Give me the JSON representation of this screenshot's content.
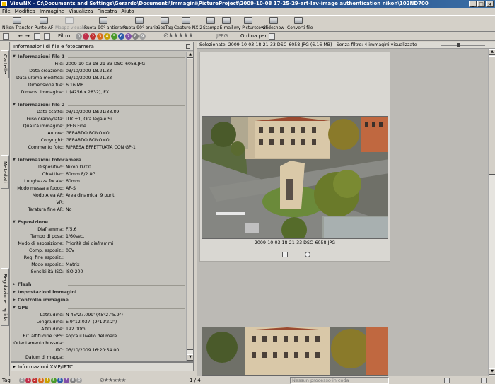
{
  "window": {
    "title": "ViewNX - C:\\Documents and Settings\\Gerardo\\Documenti\\Immagini\\PictureProject\\2009-10-08 17-25-29-art-lav-image authentication nikon\\102ND700",
    "buttons": [
      "_",
      "□",
      "×"
    ]
  },
  "menu": [
    "File",
    "Modifica",
    "Immagine",
    "Visualizza",
    "Finestra",
    "Aiuto"
  ],
  "toolbar": {
    "buttons": [
      {
        "label": "Nikon Transfer",
        "enabled": true
      },
      {
        "label": "Punto AF",
        "enabled": true
      },
      {
        "label": "Mappa visuale",
        "enabled": false
      },
      {
        "label": "Ruota 90° antiorario",
        "enabled": true
      },
      {
        "label": "Ruota 90° orario",
        "enabled": true
      },
      {
        "label": "GeoTag",
        "enabled": true
      },
      {
        "label": "Capture NX 2",
        "enabled": true
      },
      {
        "label": "Stampa",
        "enabled": true
      },
      {
        "label": "E-mail",
        "enabled": true
      },
      {
        "label": "my Picturetown",
        "enabled": true
      },
      {
        "label": "Slideshow",
        "enabled": true
      },
      {
        "label": "Converti file",
        "enabled": true
      }
    ]
  },
  "toolbar2": {
    "filter_label": "Filtro",
    "labels": [
      "0",
      "1",
      "2",
      "3",
      "4",
      "5",
      "6",
      "7",
      "8",
      "9"
    ],
    "label_colors": [
      "#9a9a9a",
      "#c0304a",
      "#c03030",
      "#d86a1c",
      "#c8a000",
      "#4a9a2a",
      "#2a5aaa",
      "#8050a8",
      "#808080",
      "#a0a0a0"
    ],
    "stars": "⊘★★★★★",
    "filetype": "JPEG",
    "sort_label": "Ordina per"
  },
  "left_tabs": [
    "Cartelle",
    "Metadati",
    "Regolazione rapida"
  ],
  "panel": {
    "title": "Informazioni di file e fotocamera",
    "sections": [
      {
        "title": "Informazioni file 1",
        "rows": [
          {
            "k": "File:",
            "v": "2009-10-03 18-21-33 DSC_6058.JPG"
          },
          {
            "k": "Data creazione:",
            "v": "03/10/2009 18.21.33"
          },
          {
            "k": "Data ultima modifica:",
            "v": "03/10/2009 18.21.33"
          },
          {
            "k": "Dimensione file:",
            "v": "6.16 MB"
          },
          {
            "k": "Dimens. immagine:",
            "v": "L (4256 x 2832), FX"
          }
        ]
      },
      {
        "title": "Informazioni file 2",
        "rows": [
          {
            "k": "Data scatto:",
            "v": "03/10/2009 18:21:33.89"
          },
          {
            "k": "Fuso orario/data:",
            "v": "UTC+1, Ora legale:Sì"
          },
          {
            "k": "Qualità immagine:",
            "v": "JPEG Fine"
          },
          {
            "k": "Autore:",
            "v": "GERARDO BONOMO"
          },
          {
            "k": "Copyright:",
            "v": "GERARDO BONOMO"
          },
          {
            "k": "Commento foto:",
            "v": "RIPRESA EFFETTUATA CON GP-1"
          }
        ]
      },
      {
        "title": "Informazioni fotocamera",
        "rows": [
          {
            "k": "Dispositivo:",
            "v": "Nikon D700"
          },
          {
            "k": "Obiettivo:",
            "v": "60mm F/2.8G"
          },
          {
            "k": "Lunghezza focale:",
            "v": "60mm"
          },
          {
            "k": "Modo messa a fuoco:",
            "v": "AF-S"
          },
          {
            "k": "Modo Area AF:",
            "v": "Area dinamica, 9 punti"
          },
          {
            "k": "VR:",
            "v": ""
          },
          {
            "k": "Taratura fine AF:",
            "v": "No"
          }
        ]
      },
      {
        "title": "Esposizione",
        "rows": [
          {
            "k": "Diaframma:",
            "v": "F/5.6"
          },
          {
            "k": "Tempo di posa:",
            "v": "1/60sec."
          },
          {
            "k": "Modo di esposizione:",
            "v": "Priorità dei diaframmi"
          },
          {
            "k": "Comp. esposiz.:",
            "v": "0EV"
          },
          {
            "k": "Reg. fine esposiz.:",
            "v": ""
          },
          {
            "k": "Modo esposiz.:",
            "v": "Matrix"
          },
          {
            "k": "Sensibilità ISO:",
            "v": "ISO 200"
          }
        ]
      },
      {
        "title": "Flash",
        "rows": []
      },
      {
        "title": "Impostazioni immagini",
        "rows": []
      },
      {
        "title": "Controllo immagine",
        "rows": []
      },
      {
        "title": "GPS",
        "rows": [
          {
            "k": "Latitudine:",
            "v": "N 45°27.099' (45°27'5.9\")"
          },
          {
            "k": "Longitudine:",
            "v": "E 9°12.037' (9°12'2.2\")"
          },
          {
            "k": "Altitudine:",
            "v": "192.00m"
          },
          {
            "k": "Rif. altitudine GPS:",
            "v": "sopra il livello del mare"
          },
          {
            "k": "Orientamento bussola:",
            "v": ""
          },
          {
            "k": "UTC:",
            "v": "03/10/2009 16:20:54.00"
          },
          {
            "k": "Datum di mappa:",
            "v": ""
          }
        ]
      }
    ],
    "footer": "Informazioni XMP/IPTC"
  },
  "main": {
    "header": "Selezionate: 2009-10-03 18-21-33 DSC_6058.JPG (6.16 MB) | Senza filtro: 4 immagini visualizzate",
    "caption": "2009-10-03 18-21-33 DSC_6058.JPG"
  },
  "status": {
    "label": "Tag",
    "count": "1 / 4",
    "process": "Nessun processo in coda"
  },
  "icons": [
    "app-icon",
    "pin-icon",
    "nikon-transfer-icon",
    "af-point-icon",
    "map-icon",
    "rotate-ccw-icon",
    "rotate-cw-icon",
    "geotag-icon",
    "capture-nx2-icon",
    "print-icon",
    "email-icon",
    "picturetown-icon",
    "slideshow-icon",
    "convert-icon",
    "grid-view-icon",
    "back-icon",
    "forward-icon",
    "up-icon",
    "folder-icon",
    "rotate-icon",
    "globe-icon",
    "queue-icon",
    "monitor-icon"
  ]
}
